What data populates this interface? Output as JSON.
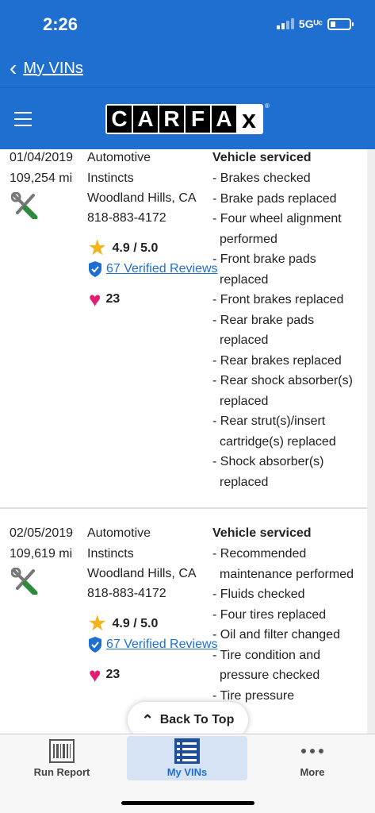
{
  "status": {
    "time": "2:26",
    "network": "5Gᵁᶜ",
    "battery_level": 0.25
  },
  "nav": {
    "back_label": "My VINs"
  },
  "header": {
    "logo_letters": [
      "C",
      "A",
      "R",
      "F",
      "A",
      "x"
    ],
    "registered": "®"
  },
  "records": [
    {
      "date": "01/04/2019",
      "mileage": "109,254 mi",
      "shop_name_1": "Automotive",
      "shop_name_2": "Instincts",
      "location": "Woodland Hills, CA",
      "phone": "818-883-4172",
      "rating": "4.9 / 5.0",
      "reviews": "67 Verified Reviews",
      "favorites": "23",
      "service_title": "Vehicle serviced",
      "services": [
        "- Brakes checked",
        "- Brake pads replaced",
        "- Four wheel alignment performed",
        "- Front brake pads replaced",
        "- Front brakes replaced",
        "- Rear brake pads replaced",
        "- Rear brakes replaced",
        "- Rear shock absorber(s) replaced",
        "- Rear strut(s)/insert cartridge(s) replaced",
        "- Shock absorber(s) replaced"
      ]
    },
    {
      "date": "02/05/2019",
      "mileage": "109,619 mi",
      "shop_name_1": "Automotive",
      "shop_name_2": "Instincts",
      "location": "Woodland Hills, CA",
      "phone": "818-883-4172",
      "rating": "4.9 / 5.0",
      "reviews": "67 Verified Reviews",
      "favorites": "23",
      "service_title": "Vehicle serviced",
      "services": [
        "- Recommended maintenance performed",
        "- Fluids checked",
        "- Four tires replaced",
        "- Oil and filter changed",
        "- Tire condition and pressure checked",
        "- Tire pressure"
      ]
    }
  ],
  "back_to_top": "Back To Top",
  "tabs": [
    {
      "label": "Run Report",
      "icon": "barcode-icon"
    },
    {
      "label": "My VINs",
      "icon": "list-icon"
    },
    {
      "label": "More",
      "icon": "more-icon"
    }
  ],
  "colors": {
    "brand_blue": "#1f6fd1",
    "star": "#f3b41b",
    "heart": "#e11d74"
  }
}
